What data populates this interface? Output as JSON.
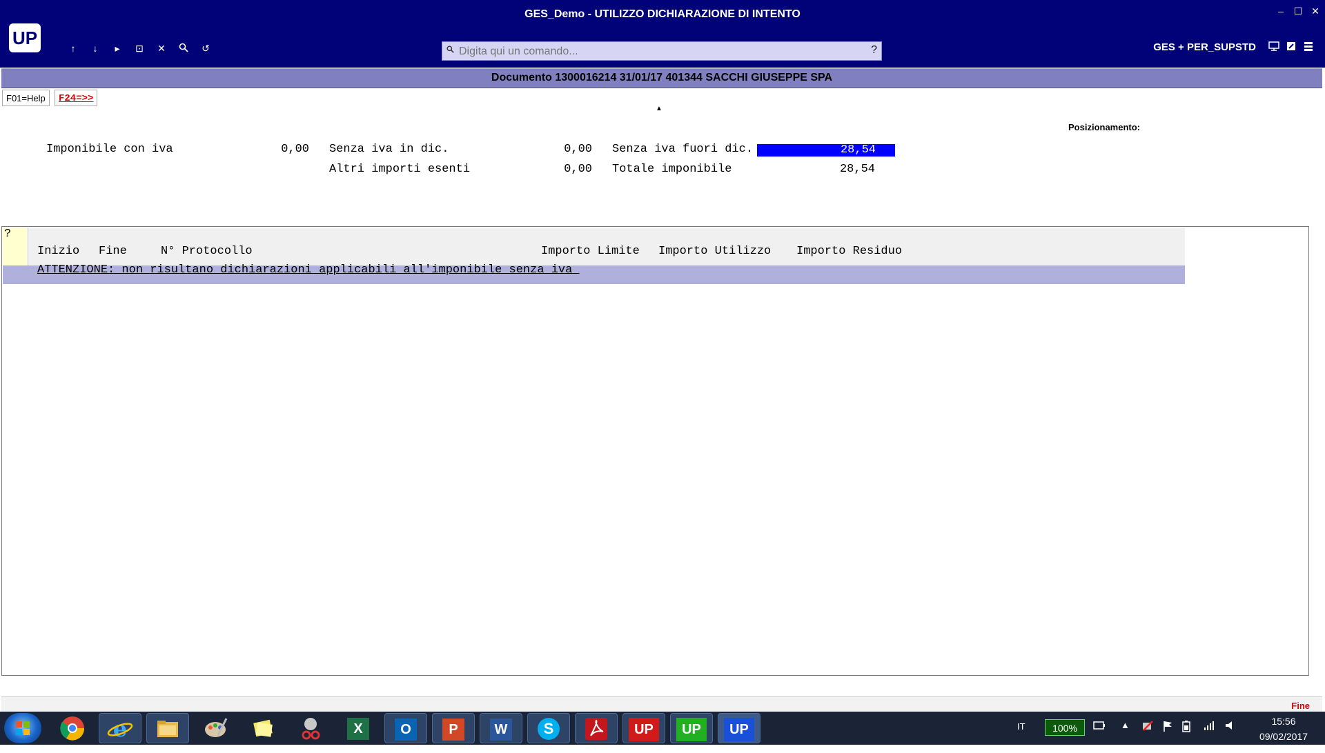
{
  "window": {
    "title": "GES_Demo - UTILIZZO DICHIARAZIONE DI INTENTO",
    "min": "–",
    "max": "☐",
    "close": "✕"
  },
  "toolbar": {
    "logo": "UP",
    "nav": [
      "↑",
      "↓",
      "▸",
      "⊡",
      "✕",
      "🔍",
      "↺"
    ],
    "command_placeholder": "Digita qui un comando...",
    "command_value": "",
    "help": "?",
    "user": "GES + PER_SUPSTD",
    "right_icons": [
      "monitor-icon",
      "edit-icon",
      "menu-icon"
    ]
  },
  "document": {
    "header": "Documento 1300016214 31/01/17 401344 SACCHI GIUSEPPE SPA"
  },
  "fkeys": {
    "f01": "F01=Help",
    "f24": "F24=>>"
  },
  "positioning_label": "Posizionamento:",
  "totals": {
    "imponibile_con_iva_label": "Imponibile con iva",
    "imponibile_con_iva": "0,00",
    "senza_iva_in_dic_label": "Senza iva in dic.",
    "senza_iva_in_dic": "0,00",
    "senza_iva_fuori_dic_label": "Senza iva fuori dic.",
    "senza_iva_fuori_dic": "28,54",
    "altri_importi_esenti_label": "Altri importi esenti",
    "altri_importi_esenti": "0,00",
    "totale_imponibile_label": "Totale imponibile",
    "totale_imponibile": "28,54"
  },
  "table": {
    "question": "?",
    "columns": [
      "Inizio",
      "Fine",
      "N° Protocollo",
      "Importo Limite",
      "Importo Utilizzo",
      "Importo Residuo"
    ],
    "warning": "ATTENZIONE: non risultano dichiarazioni applicabili all'imponibile senza iva "
  },
  "status": {
    "right": "Fine"
  },
  "taskbar": {
    "apps": [
      "Chrome",
      "Internet Explorer",
      "Esplora risorse",
      "Paint",
      "Sticky Notes",
      "Snipping Tool",
      "Excel",
      "Outlook",
      "PowerPoint",
      "Word",
      "Skype",
      "Acrobat",
      "UP",
      "UP",
      "UP"
    ],
    "app_labels": {
      "excel": "X",
      "outlook": "O",
      "powerpoint": "P",
      "word": "W",
      "skype": "S",
      "up1": "UP",
      "up2": "UP",
      "up3": "UP"
    },
    "lang": "IT",
    "battery": "100%",
    "time": "15:56",
    "date": "09/02/2017"
  }
}
